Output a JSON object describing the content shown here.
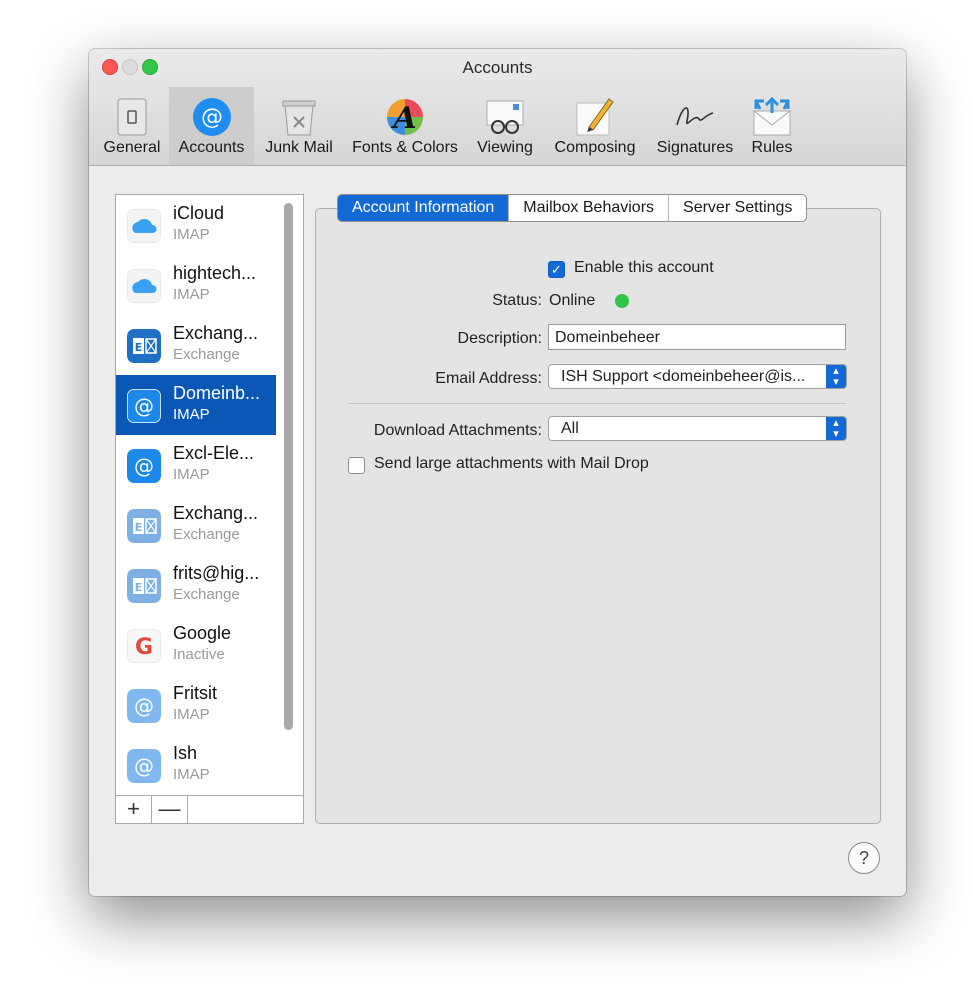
{
  "window": {
    "title": "Accounts"
  },
  "toolbar": {
    "items": [
      {
        "label": "General",
        "icon": "general-icon"
      },
      {
        "label": "Accounts",
        "icon": "at-sign-icon"
      },
      {
        "label": "Junk Mail",
        "icon": "trash-bin-icon"
      },
      {
        "label": "Fonts & Colors",
        "icon": "font-icon"
      },
      {
        "label": "Viewing",
        "icon": "glasses-icon"
      },
      {
        "label": "Composing",
        "icon": "pencil-icon"
      },
      {
        "label": "Signatures",
        "icon": "signature-icon"
      },
      {
        "label": "Rules",
        "icon": "rules-envelope-icon"
      }
    ],
    "selected": "Accounts"
  },
  "accounts": [
    {
      "name": "iCloud",
      "type": "IMAP",
      "icon": "cloud-icon"
    },
    {
      "name": "hightech...",
      "type": "IMAP",
      "icon": "cloud-icon"
    },
    {
      "name": "Exchang...",
      "type": "Exchange",
      "icon": "exchange-icon"
    },
    {
      "name": "Domeinb...",
      "type": "IMAP",
      "icon": "at-sign-icon"
    },
    {
      "name": "Excl-Ele...",
      "type": "IMAP",
      "icon": "at-sign-icon"
    },
    {
      "name": "Exchang...",
      "type": "Exchange",
      "icon": "exchange-icon"
    },
    {
      "name": "frits@hig...",
      "type": "Exchange",
      "icon": "exchange-icon"
    },
    {
      "name": "Google",
      "type": "Inactive",
      "icon": "google-icon"
    },
    {
      "name": "Fritsit",
      "type": "IMAP",
      "icon": "at-sign-icon"
    },
    {
      "name": "Ish",
      "type": "IMAP",
      "icon": "at-sign-icon"
    }
  ],
  "selected_account": "Domeinb...",
  "list_footer": {
    "add": "+",
    "remove": "—"
  },
  "tabs": [
    {
      "label": "Account Information"
    },
    {
      "label": "Mailbox Behaviors"
    },
    {
      "label": "Server Settings"
    }
  ],
  "active_tab": "Account Information",
  "form": {
    "enable_label": "Enable this account",
    "enable_checked": true,
    "status_label": "Status:",
    "status_value": "Online",
    "status_color": "#32c24a",
    "description_label": "Description:",
    "description_value": "Domeinbeheer",
    "email_label": "Email Address:",
    "email_value": "ISH Support <domeinbeheer@is...",
    "download_label": "Download Attachments:",
    "download_value": "All",
    "maildrop_label": "Send large attachments with Mail Drop",
    "maildrop_checked": false
  },
  "help": "?"
}
